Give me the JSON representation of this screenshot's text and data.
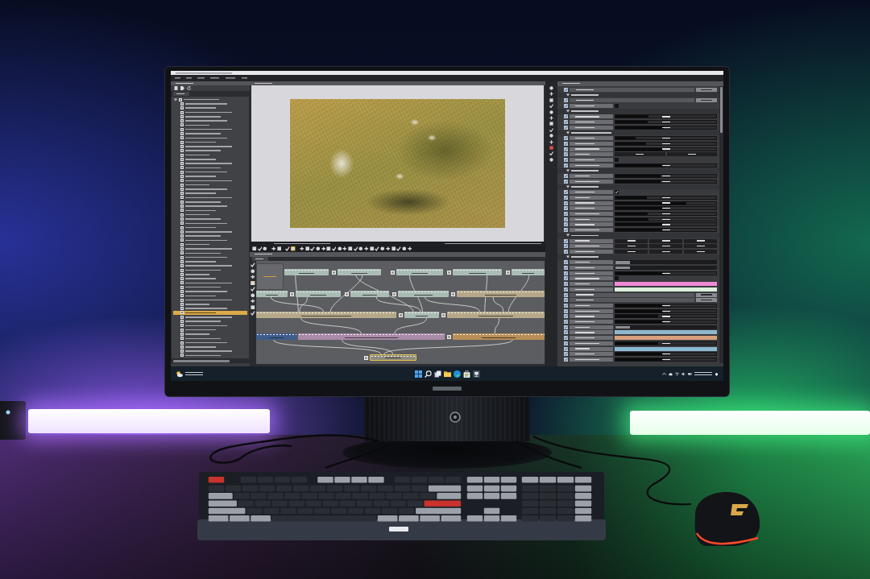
{
  "screen": {
    "outline": {
      "root": {
        "expanded": true,
        "selected": false,
        "children": [
          {
            "selected": false
          },
          {
            "selected": false
          },
          {
            "selected": false
          },
          {
            "selected": false
          },
          {
            "selected": false
          },
          {
            "selected": false
          },
          {
            "selected": false
          },
          {
            "selected": false
          },
          {
            "selected": false
          },
          {
            "selected": false
          },
          {
            "selected": false
          },
          {
            "selected": false
          },
          {
            "selected": false
          },
          {
            "selected": false
          },
          {
            "selected": false
          },
          {
            "selected": false
          },
          {
            "selected": false
          },
          {
            "selected": false
          },
          {
            "selected": false
          },
          {
            "selected": false
          },
          {
            "selected": false
          },
          {
            "selected": false
          },
          {
            "selected": false
          },
          {
            "selected": false
          },
          {
            "selected": false
          },
          {
            "selected": false
          },
          {
            "selected": false
          },
          {
            "selected": false
          },
          {
            "selected": false
          },
          {
            "selected": false
          },
          {
            "selected": false
          },
          {
            "selected": false
          },
          {
            "selected": false
          },
          {
            "selected": false
          },
          {
            "selected": false
          },
          {
            "selected": false
          },
          {
            "selected": false
          },
          {
            "selected": false
          },
          {
            "selected": false
          },
          {
            "selected": false
          },
          {
            "selected": false
          },
          {
            "selected": false
          },
          {
            "selected": false
          },
          {
            "selected": false
          },
          {
            "selected": false
          },
          {
            "selected": false
          },
          {
            "selected": false
          },
          {
            "selected": false
          },
          {
            "selected": false
          },
          {
            "selected": true
          },
          {
            "selected": false
          },
          {
            "selected": false
          },
          {
            "selected": false
          },
          {
            "selected": false
          },
          {
            "selected": false
          },
          {
            "selected": false
          },
          {
            "selected": false
          },
          {
            "selected": false
          },
          {
            "selected": false
          },
          {
            "selected": false
          }
        ]
      }
    },
    "toolbar": {
      "tools": [
        {
          "selected": false
        },
        {
          "selected": false
        },
        {
          "selected": false
        },
        {
          "selected": false
        },
        {
          "selected": false
        },
        {
          "selected": false
        },
        {
          "selected": true
        },
        {
          "selected": false
        },
        {
          "selected": false
        },
        {
          "selected": false
        },
        {
          "selected": false
        },
        {
          "selected": false
        },
        {
          "selected": false
        },
        {
          "selected": false
        },
        {
          "selected": false
        },
        {
          "selected": false
        },
        {
          "selected": false
        },
        {
          "selected": false
        },
        {
          "selected": false
        },
        {
          "selected": false
        },
        {
          "selected": false
        },
        {
          "selected": false
        },
        {
          "selected": false
        },
        {
          "selected": false
        },
        {
          "selected": false
        },
        {
          "selected": false
        },
        {
          "selected": false
        },
        {
          "selected": false
        }
      ]
    },
    "properties": {
      "rows": [
        {
          "kind": "object"
        },
        {
          "kind": "header",
          "expanded": true
        },
        {
          "kind": "object"
        },
        {
          "kind": "check",
          "checked": false
        },
        {
          "kind": "header",
          "expanded": true
        },
        {
          "kind": "slider",
          "level": 0.33
        },
        {
          "kind": "slider",
          "level": 0.32
        },
        {
          "kind": "slider",
          "level": 0.48
        },
        {
          "kind": "header",
          "expanded": true
        },
        {
          "kind": "slider",
          "level": 0.2
        },
        {
          "kind": "slider",
          "level": 0.3
        },
        {
          "kind": "slider",
          "level": 0.47
        },
        {
          "kind": "pair"
        },
        {
          "kind": "check",
          "checked": false
        },
        {
          "kind": "slider",
          "level": 0.47
        },
        {
          "kind": "header",
          "expanded": true
        },
        {
          "kind": "slider",
          "level": 0.45
        },
        {
          "kind": "slider",
          "level": 0.45
        },
        {
          "kind": "header",
          "expanded": true
        },
        {
          "kind": "check",
          "checked": true
        },
        {
          "kind": "slider",
          "level": 0.31
        },
        {
          "kind": "slider",
          "level": 0.7
        },
        {
          "kind": "slider",
          "level": 0.47
        },
        {
          "kind": "slider",
          "level": 0.32
        },
        {
          "kind": "slider",
          "level": 0.33
        },
        {
          "kind": "slider",
          "level": 0.47
        },
        {
          "kind": "slider",
          "level": 0.47
        },
        {
          "kind": "header",
          "expanded": true
        },
        {
          "kind": "triple"
        },
        {
          "kind": "triple"
        },
        {
          "kind": "triple"
        },
        {
          "kind": "header",
          "expanded": true
        },
        {
          "kind": "combo"
        },
        {
          "kind": "combo"
        },
        {
          "kind": "slider",
          "level": 0.47
        },
        {
          "kind": "check",
          "checked": false
        },
        {
          "kind": "swatch",
          "color": "#f08ad6"
        },
        {
          "kind": "swatch",
          "color": "#dcefdc"
        },
        {
          "kind": "object"
        },
        {
          "kind": "object"
        },
        {
          "kind": "slider",
          "level": 0.47
        },
        {
          "kind": "slider",
          "level": 0.47
        },
        {
          "kind": "slider",
          "level": 0.42
        },
        {
          "kind": "slider",
          "level": 0.47
        },
        {
          "kind": "combo"
        },
        {
          "kind": "swatch",
          "color": "#8fb7cc"
        },
        {
          "kind": "swatch",
          "color": "#d9a07c"
        },
        {
          "kind": "slider",
          "level": 0.42
        },
        {
          "kind": "swatch",
          "color": "#8cb9d2"
        },
        {
          "kind": "slider",
          "level": 0.47
        },
        {
          "kind": "slider",
          "level": 0.47
        }
      ]
    },
    "node_editor": {
      "node_tools": [
        {
          "selected": false
        },
        {
          "selected": false
        },
        {
          "selected": false
        },
        {
          "selected": true
        },
        {
          "selected": false
        },
        {
          "selected": false
        },
        {
          "selected": false
        },
        {
          "selected": false
        },
        {
          "selected": false
        }
      ],
      "nodes": [
        {
          "color": "#aabdb4",
          "icon": false,
          "selected": false
        },
        {
          "color": "#aabdb4",
          "icon": true,
          "selected": false
        },
        {
          "color": "#aabdb4",
          "icon": true,
          "selected": false
        },
        {
          "color": "#aabdb4",
          "icon": true,
          "selected": false
        },
        {
          "color": "#aabdb4",
          "icon": true,
          "selected": false
        },
        {
          "color": "#aabdb4",
          "icon": false,
          "selected": false
        },
        {
          "color": "#aabdb4",
          "icon": true,
          "selected": false
        },
        {
          "color": "#aabdb4",
          "icon": true,
          "selected": false
        },
        {
          "color": "#aabdb4",
          "icon": true,
          "selected": false
        },
        {
          "color": "#b6a98a",
          "icon": true,
          "selected": false
        },
        {
          "color": "#b6a98a",
          "icon": false,
          "selected": false
        },
        {
          "color": "#aabdb4",
          "icon": true,
          "selected": false
        },
        {
          "color": "#b6a98a",
          "icon": true,
          "selected": false
        },
        {
          "color": "#3d5d8e",
          "icon": false,
          "selected": false
        },
        {
          "color": "#a98aa8",
          "icon": false,
          "selected": false
        },
        {
          "color": "#b98e56",
          "icon": true,
          "selected": false
        },
        {
          "color": "#8e8c7c",
          "icon": true,
          "selected": true
        }
      ]
    }
  }
}
